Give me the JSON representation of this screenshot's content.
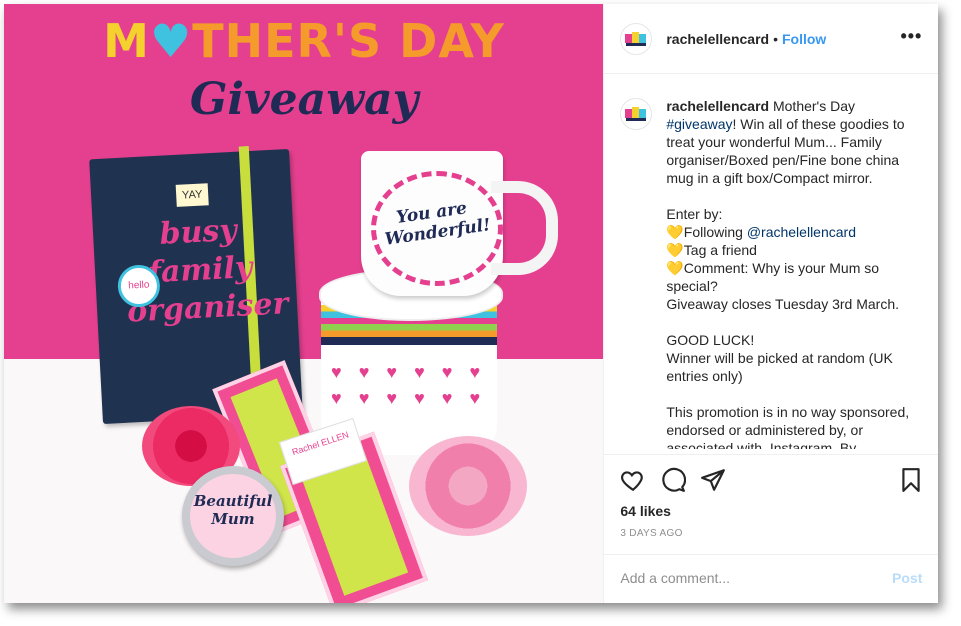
{
  "post_image": {
    "headline_line1": [
      "M",
      "♥",
      "THER'S DAY"
    ],
    "headline_line2": "Giveaway",
    "notebook_yay": "YAY",
    "notebook_hello": "hello",
    "notebook_text": "busy family organiser",
    "mug_text": "You are Wonderful!",
    "pen_tag": "Rachel ELLEN",
    "mirror_text": "Beautiful Mum",
    "box_hearts": "♥ ♥ ♥ ♥ ♥ ♥ ♥ ♥ ♥ ♥ ♥ ♥"
  },
  "header": {
    "username": "rachelellencard",
    "separator": "•",
    "follow_label": "Follow",
    "more_label": "•••"
  },
  "caption": {
    "username": "rachelellencard",
    "text_1": " Mother's Day ",
    "hashtag": "#giveaway",
    "text_2": "! Win all of these goodies to treat your wonderful Mum... Family organiser/Boxed pen/Fine bone china mug in a gift box/Compact mirror.\n\nEnter by:\n💛Following ",
    "mention": "@rachelellencard",
    "text_3": "\n💛Tag a friend\n💛Comment: Why is your Mum so special?\nGiveaway closes Tuesday 3rd March.\n\nGOOD LUCK!\nWinner will be picked at random (UK entries only)\n\nThis promotion is in no way sponsored, endorsed or administered by, or associated with, Instagram. By"
  },
  "actions": {
    "icons": [
      "heart-icon",
      "comment-icon",
      "share-icon",
      "bookmark-icon"
    ],
    "likes": "64 likes",
    "date": "3 DAYS AGO"
  },
  "comment": {
    "placeholder": "Add a comment...",
    "post_label": "Post"
  },
  "colors": {
    "follow": "#3897f0",
    "post_disabled": "#b9dcfa",
    "link": "#003569",
    "wall_pink": "#e5408f"
  }
}
